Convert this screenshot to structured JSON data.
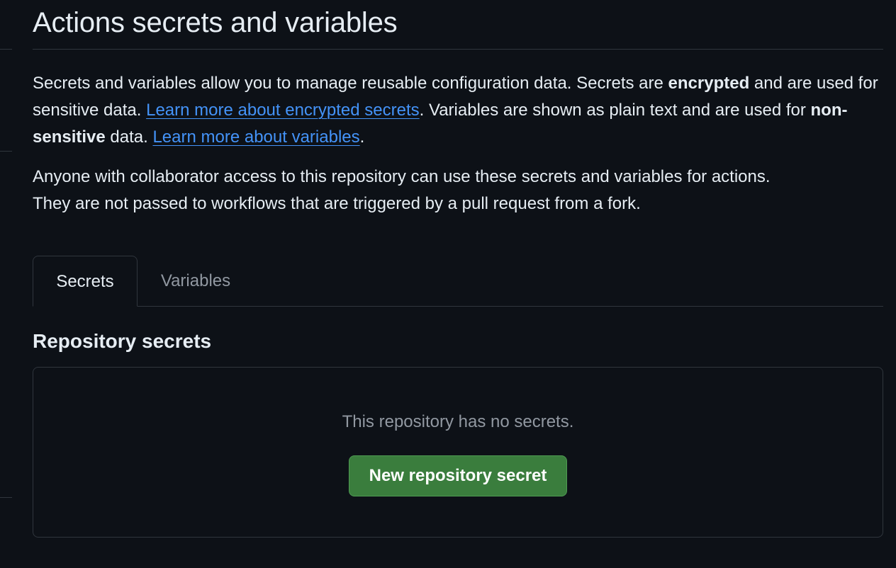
{
  "page": {
    "title": "Actions secrets and variables"
  },
  "intro": {
    "part1": "Secrets and variables allow you to manage reusable configuration data. Secrets are ",
    "encrypted": "encrypted",
    "part2": " and are used for sensitive data. ",
    "link_secrets": "Learn more about encrypted secrets",
    "part3": ". Variables are shown as plain text and are used for ",
    "non_sensitive": "non-sensitive",
    "part4": " data. ",
    "link_variables": "Learn more about variables",
    "part5": "."
  },
  "note": {
    "line1": "Anyone with collaborator access to this repository can use these secrets and variables for actions.",
    "line2": "They are not passed to workflows that are triggered by a pull request from a fork."
  },
  "tabs": [
    {
      "label": "Secrets",
      "active": true
    },
    {
      "label": "Variables",
      "active": false
    }
  ],
  "repository_secrets": {
    "title": "Repository secrets",
    "empty_message": "This repository has no secrets.",
    "new_button_label": "New repository secret"
  },
  "colors": {
    "background": "#0d1117",
    "text": "#e6edf3",
    "muted": "#9198a1",
    "link": "#4493f8",
    "border": "#30363d",
    "primary_button": "#3a7d3d"
  }
}
